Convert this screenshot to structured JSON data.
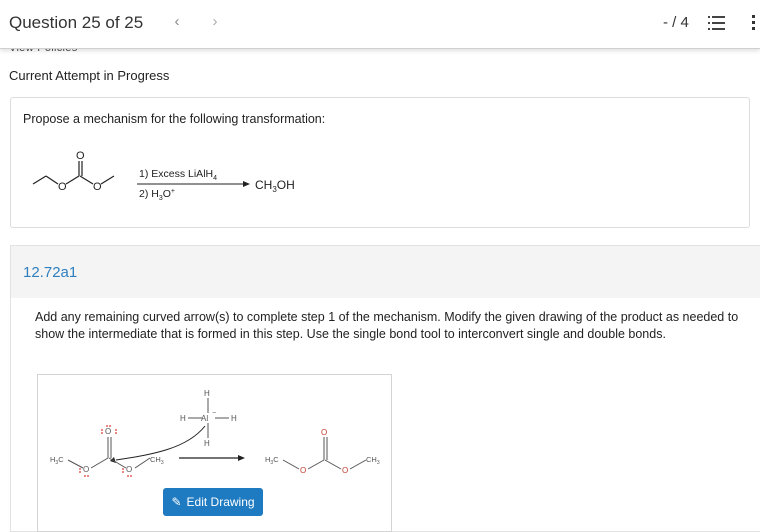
{
  "header": {
    "question_label": "Question 25 of 25",
    "prev_icon": "chevron-left-icon",
    "next_icon": "chevron-right-icon",
    "score": "- / 4",
    "list_icon": "list-icon",
    "more_icon": "more-vertical-icon"
  },
  "subheader": {
    "view_policies": "View Policies",
    "attempt_status": "Current Attempt in Progress"
  },
  "question": {
    "prompt": "Propose a mechanism for the following transformation:",
    "reagent_1": "1) Excess LiAlH",
    "reagent_1_sub": "4",
    "reagent_2": "2) H",
    "reagent_2_sub": "3",
    "reagent_2_rest": "O",
    "reagent_2_sup": "+",
    "product_main": "CH",
    "product_sub": "3",
    "product_rest": "OH",
    "oxygen": "O"
  },
  "part": {
    "id": "12.72a1",
    "instructions": "Add any remaining curved arrow(s) to complete step 1 of the mechanism. Modify the given drawing of the product as needed to show the intermediate that is formed in this step. Use the single bond tool to interconvert single and double bonds."
  },
  "mechanism": {
    "h": "H",
    "al": "Al",
    "minus": "−",
    "o": "O",
    "h3c": "H",
    "h3c_sub": "3",
    "h3c_c": "C",
    "ch": "CH",
    "ch_sub": "3"
  },
  "edit_button": {
    "label": "Edit Drawing",
    "icon": "pencil-icon"
  },
  "colors": {
    "accent": "#1f7bc1",
    "part_id": "#2f7fbf",
    "lone_pair": "#d9342b"
  }
}
